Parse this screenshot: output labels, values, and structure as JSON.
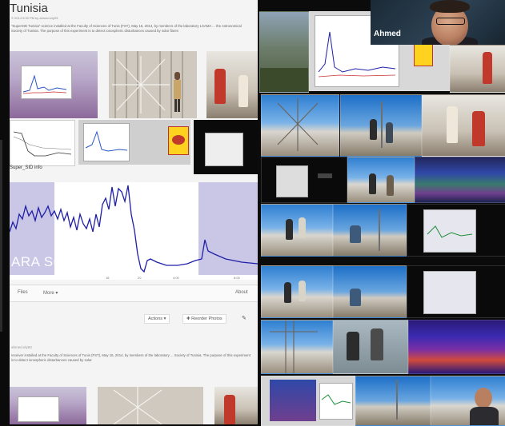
{
  "left_panel": {
    "title": "Tunisia",
    "meta": "© 2014 5:30 PM by ahmed.ely93",
    "description": "“SuperSID Tunisia” science installed at the Faculty of Sciences of Tunis (FST), May 15, 2014, by members of the laboratory LSAMA ... the Astronomical Society of Tunisia. The purpose of this experiment is to detect ionospheric disturbances caused by solar flares",
    "album_label": "Super_SID info",
    "graph_watermark": "ARA SuperSID",
    "graph_ticks": [
      "18",
      "20",
      "4:00",
      "8:00"
    ],
    "tabs": [
      "Files",
      "More ▾",
      "About"
    ],
    "actions": [
      "Actions ▾",
      "✚ Reorder Photos"
    ],
    "author": "ahmed.ely93",
    "description2": "receiver installed at the Faculty of Sciences of Tunis (FST), May 15, 2014, by members of the laboratory ... Society of Tunisia. The purpose of this experiment is to detect ionospheric disturbances caused by solar"
  },
  "video_call": {
    "participant_name": "Ahmed"
  },
  "colors": {
    "graph_line": "#1f1fa8",
    "graph_shade": "#c9c6e6",
    "background": "#0b0b0b"
  }
}
